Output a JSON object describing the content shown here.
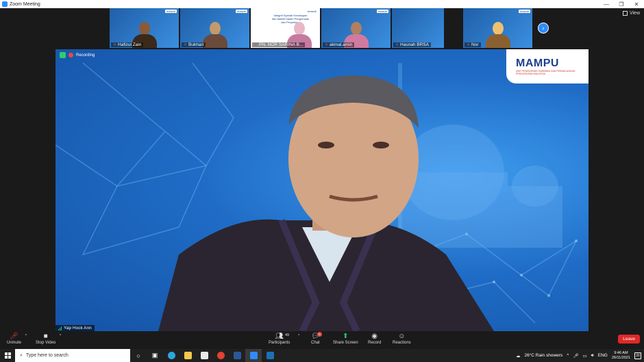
{
  "window": {
    "title": "Zoom Meeting",
    "minimize": "—",
    "restore": "❐",
    "close": "✕"
  },
  "view": {
    "label": "View"
  },
  "gallery": {
    "participants": [
      {
        "name": "Hafizul Zain",
        "badge": "#raisdb"
      },
      {
        "name": "Bukhari",
        "badge": "#raisdb"
      },
      {
        "name": "PN. NOR SARINA B...",
        "badge": "#raisdb"
      },
      {
        "name": "akmal.amin",
        "badge": "#raisdb"
      },
      {
        "name": "Hasnah BRSA",
        "badge": ""
      },
      {
        "name": "Nor",
        "badge": "#raisdb"
      }
    ],
    "slide_text": "Integriti Syariah Kecekapan dan Aktiviti Dalam Pengurusan dan Penyeliaan"
  },
  "video": {
    "recording_label": "Recording",
    "logo_name": "MAMPU",
    "logo_tagline": "UNIT PEMODENAN TADBIRAN DAN PERANCANGAN PENGURUSAN MALAYSIA",
    "speaker": "Yap Hock Ann"
  },
  "toolbar": {
    "unmute": "Unmute",
    "stop_video": "Stop Video",
    "participants": "Participants",
    "participants_count": "49",
    "chat": "Chat",
    "chat_badge": "5",
    "share_screen": "Share Screen",
    "record": "Record",
    "reactions": "Reactions",
    "leave": "Leave",
    "accent": "#2ecc71"
  },
  "taskbar": {
    "search_placeholder": "Type here to search",
    "weather": "26°C  Rain showers",
    "lang": "ENG",
    "time": "9:46 AM",
    "date": "26/11/2021",
    "notifications": "20"
  }
}
